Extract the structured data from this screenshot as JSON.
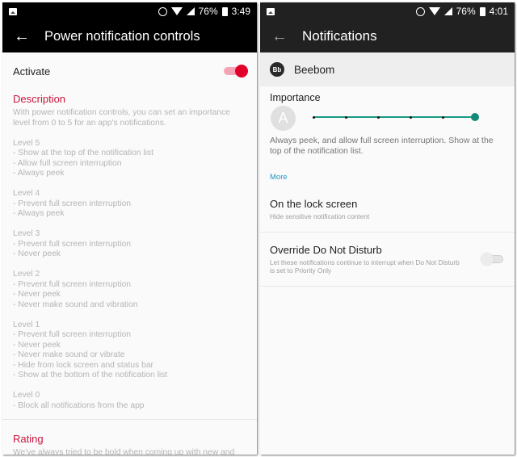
{
  "left": {
    "statusbar": {
      "battery": "76%",
      "time": "3:49"
    },
    "appbar": {
      "title": "Power notification controls"
    },
    "activate": {
      "label": "Activate",
      "enabled": true
    },
    "description": {
      "heading": "Description",
      "intro": "With power notification controls, you can set an importance level from 0 to 5 for an app's notifications.",
      "levels": [
        {
          "title": "Level 5",
          "lines": [
            "- Show at the top of the notification list",
            "- Allow full screen interruption",
            "- Always peek"
          ]
        },
        {
          "title": "Level 4",
          "lines": [
            "- Prevent full screen interruption",
            "- Always peek"
          ]
        },
        {
          "title": "Level 3",
          "lines": [
            "- Prevent full screen interruption",
            "- Never peek"
          ]
        },
        {
          "title": "Level 2",
          "lines": [
            "- Prevent full screen interruption",
            "- Never peek",
            "- Never make sound and vibration"
          ]
        },
        {
          "title": "Level 1",
          "lines": [
            "- Prevent full screen interruption",
            "- Never peek",
            "- Never make sound or vibrate",
            "- Hide from lock screen and status bar",
            "- Show at the bottom of the notification list"
          ]
        },
        {
          "title": "Level 0",
          "lines": [
            "- Block all notifications from the app"
          ]
        }
      ]
    },
    "rating": {
      "heading": "Rating",
      "text": "We've always tried to be bold when coming up with new and"
    }
  },
  "right": {
    "statusbar": {
      "battery": "76%",
      "time": "4:01"
    },
    "appbar": {
      "title": "Notifications"
    },
    "app": {
      "icon_text": "Bb",
      "name": "Beebom"
    },
    "importance": {
      "title": "Importance",
      "avatar_letter": "A",
      "level": 5,
      "max_level": 5,
      "description": "Always peek, and allow full screen interruption. Show at the top of the notification list.",
      "more_label": "More"
    },
    "lock_screen": {
      "title": "On the lock screen",
      "subtitle": "Hide sensitive notification content"
    },
    "dnd": {
      "title": "Override Do Not Disturb",
      "subtitle": "Let these notifications continue to interrupt when Do Not Disturb is set to Priority Only",
      "enabled": false
    }
  },
  "colors": {
    "accent_left": "#c8163d",
    "toggle_on": "#e0002a",
    "slider": "#1a9a85",
    "link": "#2196c8"
  }
}
